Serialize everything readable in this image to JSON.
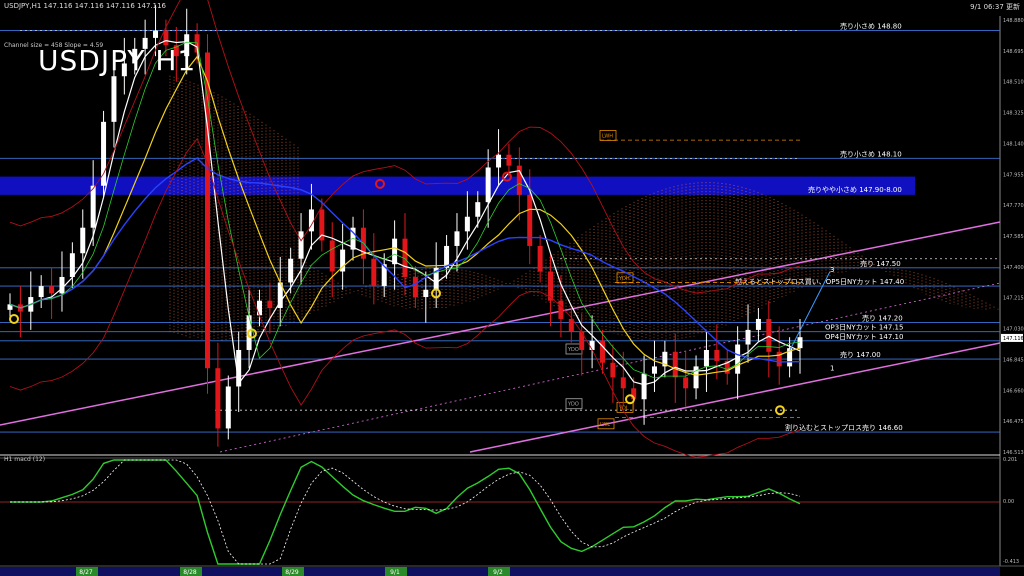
{
  "header": {
    "left": "USDJPY,H1  147.116 147.116 147.116 147.116",
    "right": "9/1 06:37 更新",
    "channel_info": "Channel size = 458 Slope = 4.59",
    "big_title": "USDJPY H1",
    "macd_label": "H1  macd (12)"
  },
  "colors": {
    "background": "#000000",
    "bull_candle": "#ffffff",
    "bear_candle": "#e0161b",
    "level_line": "#3a76d8",
    "channel_line": "#e070e0",
    "resistance_zone": "#1010c0",
    "ichimoku_cloud": "#ff7a3c",
    "macd_main": "#2ecc2e",
    "macd_signal": "#ffffff",
    "macd_below": "#ff7aa8"
  },
  "annotations": {
    "sell_1": "売り小さめ 148.80",
    "sell_2": "売り小さめ 148.10",
    "sell_zone": "売りやや小さめ 147.90-8.00",
    "sell_3": "売り 147.50",
    "stop_buy": "越えるとストップロス買い、OP5日NYカット 147.40",
    "sell_4": "売り 147.20",
    "op3": "OP3日NYカット 147.15",
    "op4": "OP4日NYカット 147.10",
    "sell_5": "売り 147.00",
    "stop_sell": "割り込むとストップロス売り 146.60"
  },
  "markers": {
    "lwh": "LWH",
    "ydh": "YDH",
    "ydo": "YDO",
    "ydl": "YDL",
    "lwl": "LWL",
    "wave3": "3",
    "wave1": "1"
  },
  "chart_data": {
    "type": "candlestick",
    "title": "USDJPY H1",
    "price_axis": {
      "range": [
        146.48,
        148.88
      ],
      "ticks": [
        "148.880",
        "148.695",
        "148.510",
        "148.325",
        "148.140",
        "147.955",
        "147.770",
        "147.585",
        "147.400",
        "147.215",
        "147.030",
        "146.845",
        "146.660",
        "146.475",
        "146.513"
      ],
      "current_price": "147.116"
    },
    "time_axis": {
      "labels": [
        "8/27",
        "8/28",
        "8/29",
        "9/1",
        "9/2"
      ]
    },
    "macd_axis": {
      "ticks": [
        "0.201",
        "0.00",
        "-0.413"
      ]
    },
    "levels": [
      {
        "price": 148.8,
        "label": "売り小さめ 148.80"
      },
      {
        "price": 148.1,
        "label": "売り小さめ 148.10"
      },
      {
        "price": 147.5,
        "label": "売り 147.50"
      },
      {
        "price": 147.4,
        "label": "越えるとストップロス買い、OP5日NYカット 147.40"
      },
      {
        "price": 147.2,
        "label": "売り 147.20"
      },
      {
        "price": 147.15,
        "label": "OP3日NYカット 147.15"
      },
      {
        "price": 147.1,
        "label": "OP4日NYカット 147.10"
      },
      {
        "price": 147.0,
        "label": "売り 147.00"
      },
      {
        "price": 146.6,
        "label": "割り込むとストップロス売り 146.60"
      }
    ],
    "zone": {
      "from": 147.9,
      "to": 148.0,
      "label": "売りやや小さめ 147.90-8.00"
    },
    "close_series": [
      147.3,
      147.26,
      147.34,
      147.4,
      147.36,
      147.45,
      147.58,
      147.72,
      147.95,
      148.3,
      148.55,
      148.62,
      148.7,
      148.76,
      148.8,
      148.72,
      148.66,
      148.78,
      148.68,
      146.95,
      146.62,
      146.85,
      147.05,
      147.24,
      147.32,
      147.28,
      147.42,
      147.55,
      147.7,
      147.82,
      147.65,
      147.48,
      147.6,
      147.72,
      147.55,
      147.4,
      147.52,
      147.66,
      147.45,
      147.34,
      147.38,
      147.5,
      147.62,
      147.7,
      147.78,
      147.86,
      148.05,
      148.12,
      148.06,
      147.9,
      147.62,
      147.48,
      147.32,
      147.22,
      147.15,
      147.05,
      147.1,
      146.98,
      146.9,
      146.84,
      146.78,
      146.92,
      146.96,
      147.04,
      146.9,
      146.84,
      146.96,
      147.05,
      146.99,
      146.92,
      147.08,
      147.16,
      147.22,
      147.04,
      146.96,
      147.06,
      147.12
    ]
  }
}
